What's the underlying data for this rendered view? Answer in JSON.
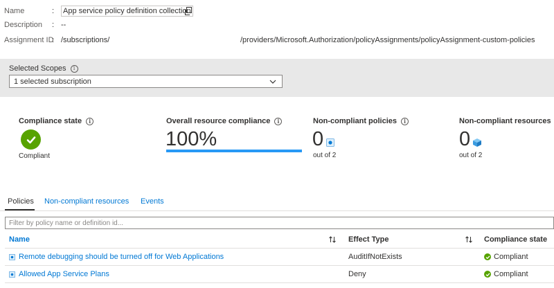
{
  "essentials": {
    "name_label": "Name",
    "name_value": "App service policy definition collection",
    "description_label": "Description",
    "description_value": "--",
    "assignment_label": "Assignment ID",
    "assignment_value": "/subscriptions/",
    "assignment_tail": "/providers/Microsoft.Authorization/policyAssignments/policyAssignment-custom-policies",
    "colon": ":"
  },
  "scope": {
    "label": "Selected Scopes",
    "selected": "1 selected subscription"
  },
  "metrics": {
    "compliance_state": {
      "title": "Compliance state",
      "value": "Compliant"
    },
    "overall": {
      "title": "Overall resource compliance",
      "value": "100%",
      "percent": 100
    },
    "noncompliant_policies": {
      "title": "Non-compliant policies",
      "value": "0",
      "sub": "out of 2"
    },
    "noncompliant_resources": {
      "title": "Non-compliant resources",
      "value": "0",
      "sub": "out of 2"
    }
  },
  "tabs": [
    {
      "label": "Policies",
      "active": true
    },
    {
      "label": "Non-compliant resources",
      "active": false
    },
    {
      "label": "Events",
      "active": false
    }
  ],
  "filter": {
    "placeholder": "Filter by policy name or definition id..."
  },
  "table": {
    "columns": [
      "Name",
      "Effect Type",
      "Compliance state"
    ],
    "rows": [
      {
        "name": "Remote debugging should be turned off for Web Applications",
        "effect": "AuditIfNotExists",
        "state": "Compliant"
      },
      {
        "name": "Allowed App Service Plans",
        "effect": "Deny",
        "state": "Compliant"
      }
    ]
  },
  "colors": {
    "accent": "#0078d4",
    "success": "#57a300",
    "progress": "#2899f5",
    "band": "#e8e8e8"
  },
  "icons": {
    "copy": "copy-icon",
    "info": "info-icon",
    "chevron": "chevron-down-icon",
    "check": "check-circle-icon",
    "policy": "policy-icon",
    "resource": "cube-icon",
    "sort": "sort-arrows-icon"
  }
}
